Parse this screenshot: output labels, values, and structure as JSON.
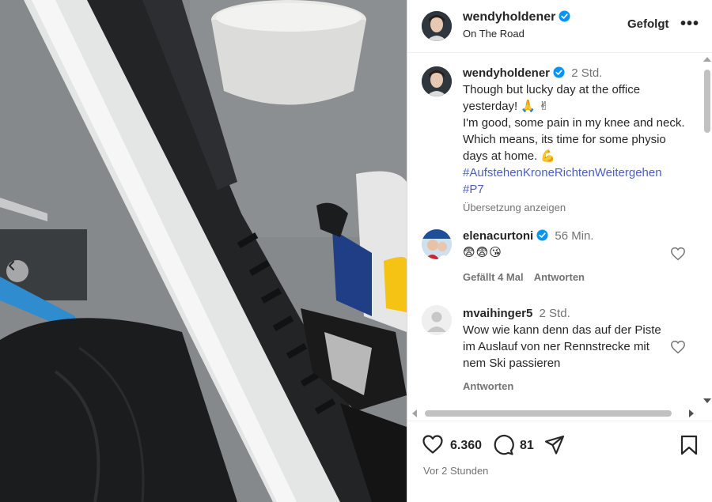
{
  "header": {
    "username": "wendyholdener",
    "location": "On The Road",
    "follow_label": "Gefolgt",
    "more_label": "•••"
  },
  "caption": {
    "username": "wendyholdener",
    "time": "2 Std.",
    "text_line1": "Though but lucky day at the office yesterday! 🙏 ✌",
    "text_line2": "I'm good, some pain in my knee and neck. Which means, its time for some physio days at home. 💪",
    "hashtag1": "#AufstehenKroneRichtenWeitergehen",
    "hashtag2": "#P7",
    "translate_label": "Übersetzung anzeigen"
  },
  "comments": [
    {
      "username": "elenacurtoni",
      "time": "56 Min.",
      "text": "😨😨😘",
      "likes_label": "Gefällt 4 Mal",
      "reply_label": "Antworten"
    },
    {
      "username": "mvaihinger5",
      "time": "2 Std.",
      "text": "Wow wie kann denn das auf der Piste im Auslauf von ner Rennstrecke mit nem Ski passieren",
      "reply_label": "Antworten"
    }
  ],
  "footer": {
    "likes_count": "6.360",
    "comments_count": "81",
    "timestamp": "Vor 2 Stunden"
  },
  "colors": {
    "verified": "#0095f6",
    "hashtag": "#4a5fc1",
    "secondary_text": "#737373"
  }
}
